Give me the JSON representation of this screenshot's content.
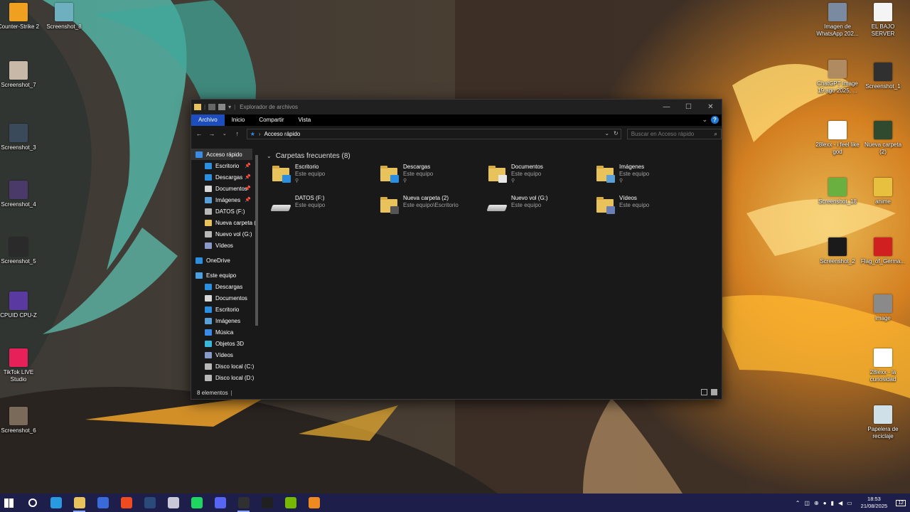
{
  "window": {
    "title": "Explorador de archivos",
    "ribbon_tabs": [
      "Archivo",
      "Inicio",
      "Compartir",
      "Vista"
    ],
    "help_label": "?",
    "minimize": "—",
    "maximize": "☐",
    "close": "✕"
  },
  "address": {
    "path": "Acceso rápido",
    "search_placeholder": "Buscar en Acceso rápido"
  },
  "nav_pane": {
    "items": [
      {
        "label": "Acceso rápido",
        "level": 1,
        "selected": true,
        "pinned": false,
        "icon": "star-icon"
      },
      {
        "label": "Escritorio",
        "level": 2,
        "pinned": true,
        "icon": "desktop-icon"
      },
      {
        "label": "Descargas",
        "level": 2,
        "pinned": true,
        "icon": "download-icon"
      },
      {
        "label": "Documentos",
        "level": 2,
        "pinned": true,
        "icon": "document-icon"
      },
      {
        "label": "Imágenes",
        "level": 2,
        "pinned": true,
        "icon": "pictures-icon"
      },
      {
        "label": "DATOS (F:)",
        "level": 2,
        "pinned": false,
        "icon": "drive-icon"
      },
      {
        "label": "Nueva carpeta (2",
        "level": 2,
        "pinned": false,
        "icon": "folder-icon"
      },
      {
        "label": "Nuevo vol (G:)",
        "level": 2,
        "pinned": false,
        "icon": "drive-icon"
      },
      {
        "label": "Vídeos",
        "level": 2,
        "pinned": false,
        "icon": "video-icon"
      },
      {
        "label": "",
        "level": 0,
        "spacer": true
      },
      {
        "label": "OneDrive",
        "level": 1,
        "pinned": false,
        "icon": "cloud-icon"
      },
      {
        "label": "",
        "level": 0,
        "spacer": true
      },
      {
        "label": "Este equipo",
        "level": 1,
        "pinned": false,
        "icon": "computer-icon"
      },
      {
        "label": "Descargas",
        "level": 2,
        "pinned": false,
        "icon": "download-icon"
      },
      {
        "label": "Documentos",
        "level": 2,
        "pinned": false,
        "icon": "document-icon"
      },
      {
        "label": "Escritorio",
        "level": 2,
        "pinned": false,
        "icon": "desktop-icon"
      },
      {
        "label": "Imágenes",
        "level": 2,
        "pinned": false,
        "icon": "pictures-icon"
      },
      {
        "label": "Música",
        "level": 2,
        "pinned": false,
        "icon": "music-icon"
      },
      {
        "label": "Objetos 3D",
        "level": 2,
        "pinned": false,
        "icon": "cube-icon"
      },
      {
        "label": "Vídeos",
        "level": 2,
        "pinned": false,
        "icon": "video-icon"
      },
      {
        "label": "Disco local (C:)",
        "level": 2,
        "pinned": false,
        "icon": "drive-icon"
      },
      {
        "label": "Disco local (D:)",
        "level": 2,
        "pinned": false,
        "icon": "drive-icon"
      }
    ]
  },
  "main": {
    "group_title": "Carpetas frecuentes (8)",
    "tiles": [
      {
        "name": "Escritorio",
        "sub": "Este equipo",
        "pinned": true,
        "kind": "folder",
        "badge": "#2a8fe0"
      },
      {
        "name": "Descargas",
        "sub": "Este equipo",
        "pinned": true,
        "kind": "folder",
        "badge": "#2a8fe0"
      },
      {
        "name": "Documentos",
        "sub": "Este equipo",
        "pinned": true,
        "kind": "folder",
        "badge": "#e8e8e8"
      },
      {
        "name": "Imágenes",
        "sub": "Este equipo",
        "pinned": true,
        "kind": "folder",
        "badge": "#5aa0d8"
      },
      {
        "name": "DATOS (F:)",
        "sub": "Este equipo",
        "pinned": false,
        "kind": "drive",
        "badge": ""
      },
      {
        "name": "Nueva carpeta (2)",
        "sub": "Este equipo\\Escritorio",
        "pinned": false,
        "kind": "folder",
        "badge": "#555555"
      },
      {
        "name": "Nuevo vol (G:)",
        "sub": "Este equipo",
        "pinned": false,
        "kind": "drive",
        "badge": ""
      },
      {
        "name": "Vídeos",
        "sub": "Este equipo",
        "pinned": false,
        "kind": "folder",
        "badge": "#6a7fb8"
      }
    ]
  },
  "status_bar": {
    "count": "8 elementos"
  },
  "desktop_icons_left": [
    {
      "label": "Counter-Strike 2",
      "color": "#f0a020"
    },
    {
      "label": "Screenshot_8",
      "color": "#6fb0c0"
    },
    {
      "label": "Screenshot_7",
      "color": "#c8b8a8"
    },
    {
      "label": "Screenshot_3",
      "color": "#3a4a5a"
    },
    {
      "label": "Screenshot_4",
      "color": "#4a3a6a"
    },
    {
      "label": "Screenshot_5",
      "color": "#2a2a2a"
    },
    {
      "label": "CPUID CPU-Z",
      "color": "#5a3aa0"
    },
    {
      "label": "TikTok LIVE Studio",
      "color": "#e8205a"
    },
    {
      "label": "Screenshot_6",
      "color": "#7a6a5a"
    }
  ],
  "desktop_icons_right": [
    {
      "label": "Imagen de WhatsApp 202...",
      "color": "#7a8aa0"
    },
    {
      "label": "EL BAJO SERVER",
      "color": "#f4f4f4"
    },
    {
      "label": "ChatGPT Image 19 ago 2025, ...",
      "color": "#b08a60"
    },
    {
      "label": "Screenshot_1",
      "color": "#303030"
    },
    {
      "label": "28lexx - i feel like god",
      "color": "#ffffff"
    },
    {
      "label": "Nueva carpeta (2)",
      "color": "#304a30"
    },
    {
      "label": "Screenshot_18",
      "color": "#6ab040"
    },
    {
      "label": "anime",
      "color": "#e8c040"
    },
    {
      "label": "Screenshot_2",
      "color": "#1a1a1a"
    },
    {
      "label": "Flag_of_Germa...",
      "color": "#d02020"
    },
    {
      "label": "image",
      "color": "#8a8a8a"
    },
    {
      "label": "28lexx - la curiosidad",
      "color": "#ffffff"
    },
    {
      "label": "Papelera de reciclaje",
      "color": "#d0e0e8"
    }
  ],
  "taskbar": {
    "apps": [
      {
        "name": "windows-start-icon",
        "color": "#ffffff"
      },
      {
        "name": "search-icon",
        "color": "#ffffff"
      },
      {
        "name": "edge-icon",
        "color": "#2a9ae0"
      },
      {
        "name": "file-explorer-icon",
        "color": "#e8c25a",
        "active": true
      },
      {
        "name": "store-icon",
        "color": "#3a6ad8"
      },
      {
        "name": "brave-icon",
        "color": "#f04a20"
      },
      {
        "name": "steam-icon",
        "color": "#2a4a7a"
      },
      {
        "name": "app-icon",
        "color": "#c8c8d8"
      },
      {
        "name": "spotify-icon",
        "color": "#1ed760"
      },
      {
        "name": "discord-icon",
        "color": "#5865f2"
      },
      {
        "name": "obs-icon",
        "color": "#303030",
        "active": true
      },
      {
        "name": "epic-games-icon",
        "color": "#202020"
      },
      {
        "name": "nvidia-icon",
        "color": "#76b900"
      },
      {
        "name": "app2-icon",
        "color": "#f08a20"
      }
    ],
    "time": "18:53",
    "date": "21/08/2025",
    "notifications": "12"
  }
}
